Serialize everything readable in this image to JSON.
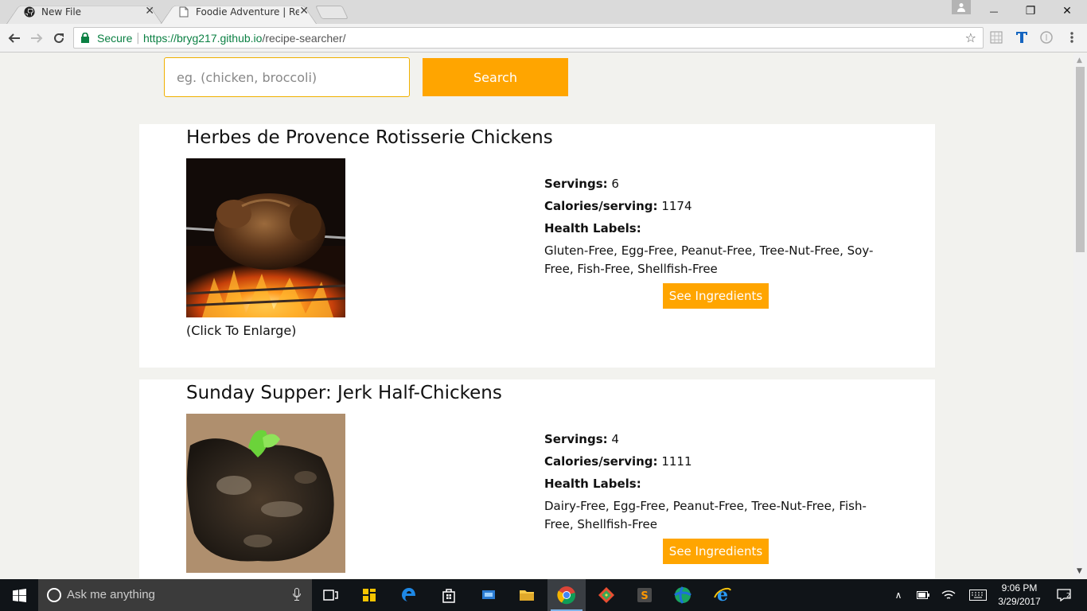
{
  "browser": {
    "tabs": [
      {
        "title": "New File",
        "close": "✕"
      },
      {
        "title": "Foodie Adventure | Recip",
        "close": "✕"
      }
    ],
    "window_controls": {
      "minimize": "—",
      "restore": "❐",
      "close": "✕"
    },
    "secure_label": "Secure",
    "url_host": "https://bryg217.github.io",
    "url_path": "/recipe-searcher/"
  },
  "search": {
    "placeholder": "eg. (chicken, broccoli)",
    "button_label": "Search"
  },
  "recipes": [
    {
      "title": "Herbes de Provence Rotisserie Chickens",
      "enlarge_label": "(Click To Enlarge)",
      "servings_label": "Servings:",
      "servings": "6",
      "calories_label": "Calories/serving:",
      "calories": "1174",
      "health_label": "Health Labels:",
      "health_labels": "Gluten-Free, Egg-Free, Peanut-Free, Tree-Nut-Free, Soy-Free, Fish-Free, Shellfish-Free",
      "button_label": "See Ingredients"
    },
    {
      "title": "Sunday Supper: Jerk Half-Chickens",
      "servings_label": "Servings:",
      "servings": "4",
      "calories_label": "Calories/serving:",
      "calories": "1111",
      "health_label": "Health Labels:",
      "health_labels": "Dairy-Free, Egg-Free, Peanut-Free, Tree-Nut-Free, Fish-Free, Shellfish-Free",
      "button_label": "See Ingredients"
    }
  ],
  "taskbar": {
    "cortana_placeholder": "Ask me anything",
    "time": "9:06 PM",
    "date": "3/29/2017"
  },
  "colors": {
    "accent": "#ffa500",
    "page_bg": "#f2f2ee",
    "card_bg": "#ffffff",
    "secure_green": "#0b8043"
  }
}
